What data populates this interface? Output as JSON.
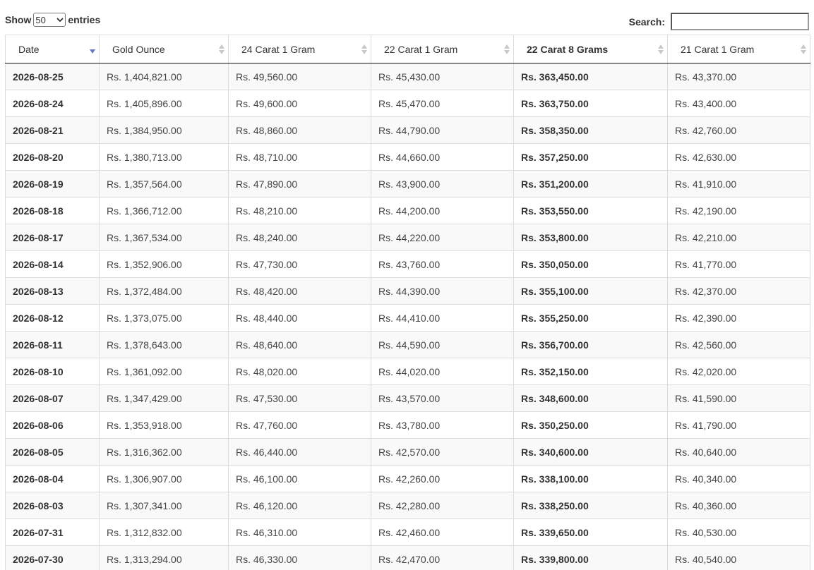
{
  "controls": {
    "show_label": "Show",
    "length_value": "50",
    "entries_label": "entries",
    "search_label": "Search:",
    "search_value": ""
  },
  "colors": {
    "sort_active": "#6b74c4",
    "sort_inactive": "#c8c8c8",
    "row_odd": "#f9f9f9",
    "row_even": "#ffffff"
  },
  "table": {
    "columns": [
      {
        "label": "Date",
        "sort": "desc"
      },
      {
        "label": "Gold Ounce",
        "sort": "none"
      },
      {
        "label": "24 Carat 1 Gram",
        "sort": "none"
      },
      {
        "label": "22 Carat 1 Gram",
        "sort": "none"
      },
      {
        "label": "22 Carat 8 Grams",
        "sort": "none"
      },
      {
        "label": "21 Carat 1 Gram",
        "sort": "none"
      }
    ],
    "rows": [
      [
        "2026-08-25",
        "Rs. 1,404,821.00",
        "Rs. 49,560.00",
        "Rs. 45,430.00",
        "Rs. 363,450.00",
        "Rs. 43,370.00"
      ],
      [
        "2026-08-24",
        "Rs. 1,405,896.00",
        "Rs. 49,600.00",
        "Rs. 45,470.00",
        "Rs. 363,750.00",
        "Rs. 43,400.00"
      ],
      [
        "2026-08-21",
        "Rs. 1,384,950.00",
        "Rs. 48,860.00",
        "Rs. 44,790.00",
        "Rs. 358,350.00",
        "Rs. 42,760.00"
      ],
      [
        "2026-08-20",
        "Rs. 1,380,713.00",
        "Rs. 48,710.00",
        "Rs. 44,660.00",
        "Rs. 357,250.00",
        "Rs. 42,630.00"
      ],
      [
        "2026-08-19",
        "Rs. 1,357,564.00",
        "Rs. 47,890.00",
        "Rs. 43,900.00",
        "Rs. 351,200.00",
        "Rs. 41,910.00"
      ],
      [
        "2026-08-18",
        "Rs. 1,366,712.00",
        "Rs. 48,210.00",
        "Rs. 44,200.00",
        "Rs. 353,550.00",
        "Rs. 42,190.00"
      ],
      [
        "2026-08-17",
        "Rs. 1,367,534.00",
        "Rs. 48,240.00",
        "Rs. 44,220.00",
        "Rs. 353,800.00",
        "Rs. 42,210.00"
      ],
      [
        "2026-08-14",
        "Rs. 1,352,906.00",
        "Rs. 47,730.00",
        "Rs. 43,760.00",
        "Rs. 350,050.00",
        "Rs. 41,770.00"
      ],
      [
        "2026-08-13",
        "Rs. 1,372,484.00",
        "Rs. 48,420.00",
        "Rs. 44,390.00",
        "Rs. 355,100.00",
        "Rs. 42,370.00"
      ],
      [
        "2026-08-12",
        "Rs. 1,373,075.00",
        "Rs. 48,440.00",
        "Rs. 44,410.00",
        "Rs. 355,250.00",
        "Rs. 42,390.00"
      ],
      [
        "2026-08-11",
        "Rs. 1,378,643.00",
        "Rs. 48,640.00",
        "Rs. 44,590.00",
        "Rs. 356,700.00",
        "Rs. 42,560.00"
      ],
      [
        "2026-08-10",
        "Rs. 1,361,092.00",
        "Rs. 48,020.00",
        "Rs. 44,020.00",
        "Rs. 352,150.00",
        "Rs. 42,020.00"
      ],
      [
        "2026-08-07",
        "Rs. 1,347,429.00",
        "Rs. 47,530.00",
        "Rs. 43,570.00",
        "Rs. 348,600.00",
        "Rs. 41,590.00"
      ],
      [
        "2026-08-06",
        "Rs. 1,353,918.00",
        "Rs. 47,760.00",
        "Rs. 43,780.00",
        "Rs. 350,250.00",
        "Rs. 41,790.00"
      ],
      [
        "2026-08-05",
        "Rs. 1,316,362.00",
        "Rs. 46,440.00",
        "Rs. 42,570.00",
        "Rs. 340,600.00",
        "Rs. 40,640.00"
      ],
      [
        "2026-08-04",
        "Rs. 1,306,907.00",
        "Rs. 46,100.00",
        "Rs. 42,260.00",
        "Rs. 338,100.00",
        "Rs. 40,340.00"
      ],
      [
        "2026-08-03",
        "Rs. 1,307,341.00",
        "Rs. 46,120.00",
        "Rs. 42,280.00",
        "Rs. 338,250.00",
        "Rs. 40,360.00"
      ],
      [
        "2026-07-31",
        "Rs. 1,312,832.00",
        "Rs. 46,310.00",
        "Rs. 42,460.00",
        "Rs. 339,650.00",
        "Rs. 40,530.00"
      ],
      [
        "2026-07-30",
        "Rs. 1,313,294.00",
        "Rs. 46,330.00",
        "Rs. 42,470.00",
        "Rs. 339,800.00",
        "Rs. 40,540.00"
      ]
    ]
  }
}
